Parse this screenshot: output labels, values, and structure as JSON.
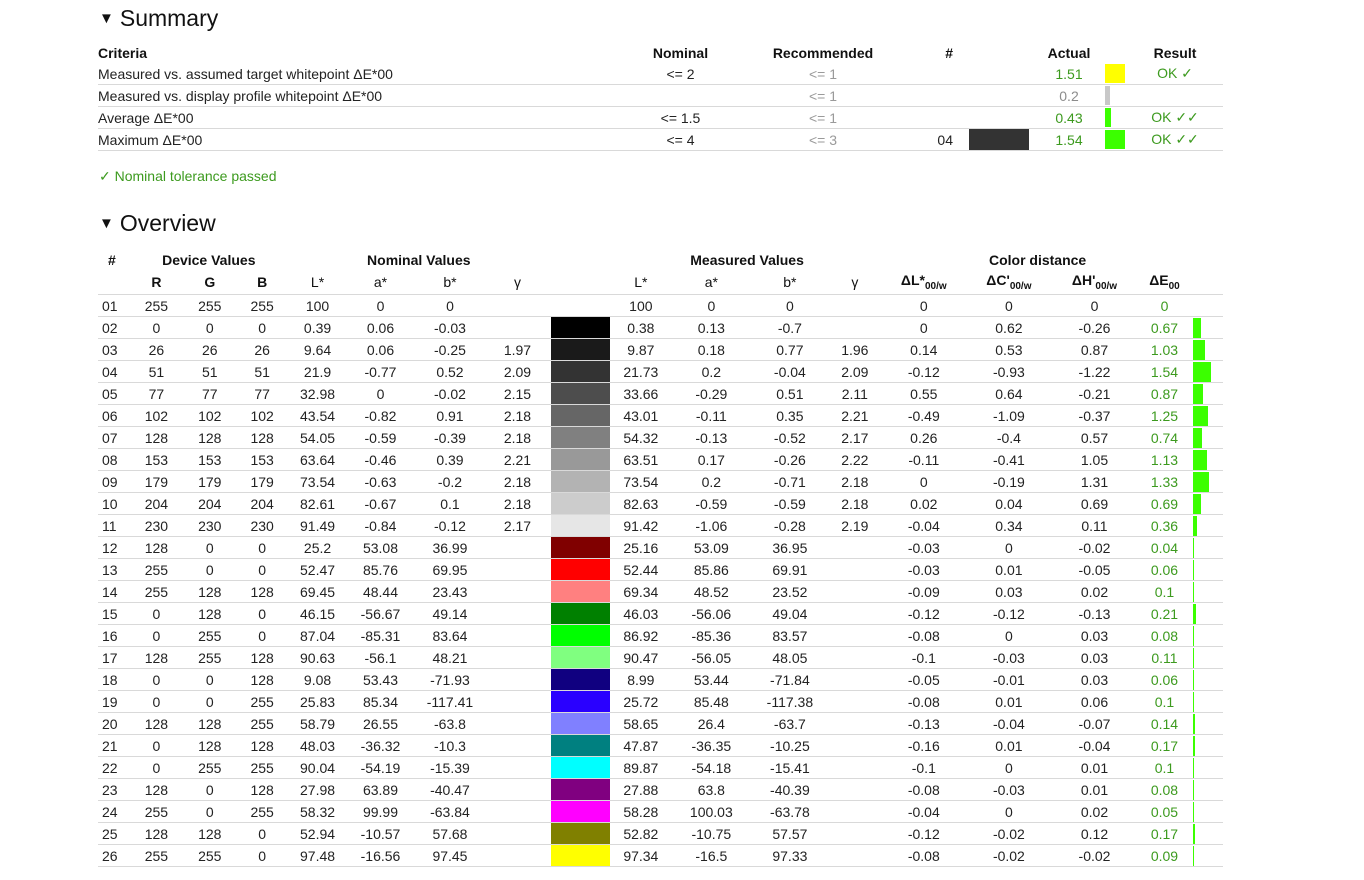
{
  "summary": {
    "title": "Summary",
    "headers": {
      "criteria": "Criteria",
      "nominal": "Nominal",
      "recommended": "Recommended",
      "hash": "#",
      "actual": "Actual",
      "result": "Result"
    },
    "rows": [
      {
        "criteria": "Measured vs. assumed target whitepoint ΔE*00",
        "nominal": "<= 2",
        "recommended": "<= 1",
        "patch": "",
        "actual": "1.51",
        "result": "OK ✓",
        "bar_color": "#ffff00",
        "actual_style": "green",
        "bar_fraction": 1.0
      },
      {
        "criteria": "Measured vs. display profile whitepoint ΔE*00",
        "nominal": "",
        "recommended": "<= 1",
        "patch": "",
        "actual": "0.2",
        "result": "",
        "bar_color": "#c8c8c8",
        "actual_style": "grey",
        "bar_fraction": 0.25
      },
      {
        "criteria": "Average ΔE*00",
        "nominal": "<= 1.5",
        "recommended": "<= 1",
        "patch": "",
        "actual": "0.43",
        "result": "OK ✓✓",
        "bar_color": "#3bff00",
        "actual_style": "green",
        "bar_fraction": 0.3
      },
      {
        "criteria": "Maximum ΔE*00",
        "nominal": "<= 4",
        "recommended": "<= 3",
        "patch": "04",
        "actual": "1.54",
        "result": "OK ✓✓",
        "bar_color": "#3bff00",
        "actual_style": "green",
        "bar_fraction": 1.0,
        "patch_color": "#333333"
      }
    ],
    "passed_text": "✓ Nominal tolerance passed"
  },
  "overview": {
    "title": "Overview",
    "group_headers": {
      "hash": "#",
      "device": "Device Values",
      "nominal": "Nominal Values",
      "measured": "Measured Values",
      "distance": "Color distance"
    },
    "sub_headers": [
      "R",
      "G",
      "B",
      "L*",
      "a*",
      "b*",
      "γ",
      "L*",
      "a*",
      "b*",
      "γ"
    ],
    "rows": [
      {
        "n": "01",
        "r": "255",
        "g": "255",
        "b": "255",
        "nl": "100",
        "na": "0",
        "nb": "0",
        "ng": "",
        "color": "#ffffff",
        "ml": "100",
        "ma": "0",
        "mb": "0",
        "mg": "",
        "dl": "0",
        "dc": "0",
        "dh": "0",
        "de": "0",
        "bar": 0
      },
      {
        "n": "02",
        "r": "0",
        "g": "0",
        "b": "0",
        "nl": "0.39",
        "na": "0.06",
        "nb": "-0.03",
        "ng": "",
        "color": "#000000",
        "ml": "0.38",
        "ma": "0.13",
        "mb": "-0.7",
        "mg": "",
        "dl": "0",
        "dc": "0.62",
        "dh": "-0.26",
        "de": "0.67",
        "bar": 0.67
      },
      {
        "n": "03",
        "r": "26",
        "g": "26",
        "b": "26",
        "nl": "9.64",
        "na": "0.06",
        "nb": "-0.25",
        "ng": "1.97",
        "color": "#1a1a1a",
        "ml": "9.87",
        "ma": "0.18",
        "mb": "0.77",
        "mg": "1.96",
        "dl": "0.14",
        "dc": "0.53",
        "dh": "0.87",
        "de": "1.03",
        "bar": 1.03
      },
      {
        "n": "04",
        "r": "51",
        "g": "51",
        "b": "51",
        "nl": "21.9",
        "na": "-0.77",
        "nb": "0.52",
        "ng": "2.09",
        "color": "#333333",
        "ml": "21.73",
        "ma": "0.2",
        "mb": "-0.04",
        "mg": "2.09",
        "dl": "-0.12",
        "dc": "-0.93",
        "dh": "-1.22",
        "de": "1.54",
        "bar": 1.54
      },
      {
        "n": "05",
        "r": "77",
        "g": "77",
        "b": "77",
        "nl": "32.98",
        "na": "0",
        "nb": "-0.02",
        "ng": "2.15",
        "color": "#4d4d4d",
        "ml": "33.66",
        "ma": "-0.29",
        "mb": "0.51",
        "mg": "2.11",
        "dl": "0.55",
        "dc": "0.64",
        "dh": "-0.21",
        "de": "0.87",
        "bar": 0.87
      },
      {
        "n": "06",
        "r": "102",
        "g": "102",
        "b": "102",
        "nl": "43.54",
        "na": "-0.82",
        "nb": "0.91",
        "ng": "2.18",
        "color": "#666666",
        "ml": "43.01",
        "ma": "-0.11",
        "mb": "0.35",
        "mg": "2.21",
        "dl": "-0.49",
        "dc": "-1.09",
        "dh": "-0.37",
        "de": "1.25",
        "bar": 1.25
      },
      {
        "n": "07",
        "r": "128",
        "g": "128",
        "b": "128",
        "nl": "54.05",
        "na": "-0.59",
        "nb": "-0.39",
        "ng": "2.18",
        "color": "#808080",
        "ml": "54.32",
        "ma": "-0.13",
        "mb": "-0.52",
        "mg": "2.17",
        "dl": "0.26",
        "dc": "-0.4",
        "dh": "0.57",
        "de": "0.74",
        "bar": 0.74
      },
      {
        "n": "08",
        "r": "153",
        "g": "153",
        "b": "153",
        "nl": "63.64",
        "na": "-0.46",
        "nb": "0.39",
        "ng": "2.21",
        "color": "#999999",
        "ml": "63.51",
        "ma": "0.17",
        "mb": "-0.26",
        "mg": "2.22",
        "dl": "-0.11",
        "dc": "-0.41",
        "dh": "1.05",
        "de": "1.13",
        "bar": 1.13
      },
      {
        "n": "09",
        "r": "179",
        "g": "179",
        "b": "179",
        "nl": "73.54",
        "na": "-0.63",
        "nb": "-0.2",
        "ng": "2.18",
        "color": "#b3b3b3",
        "ml": "73.54",
        "ma": "0.2",
        "mb": "-0.71",
        "mg": "2.18",
        "dl": "0",
        "dc": "-0.19",
        "dh": "1.31",
        "de": "1.33",
        "bar": 1.33
      },
      {
        "n": "10",
        "r": "204",
        "g": "204",
        "b": "204",
        "nl": "82.61",
        "na": "-0.67",
        "nb": "0.1",
        "ng": "2.18",
        "color": "#cccccc",
        "ml": "82.63",
        "ma": "-0.59",
        "mb": "-0.59",
        "mg": "2.18",
        "dl": "0.02",
        "dc": "0.04",
        "dh": "0.69",
        "de": "0.69",
        "bar": 0.69
      },
      {
        "n": "11",
        "r": "230",
        "g": "230",
        "b": "230",
        "nl": "91.49",
        "na": "-0.84",
        "nb": "-0.12",
        "ng": "2.17",
        "color": "#e6e6e6",
        "ml": "91.42",
        "ma": "-1.06",
        "mb": "-0.28",
        "mg": "2.19",
        "dl": "-0.04",
        "dc": "0.34",
        "dh": "0.11",
        "de": "0.36",
        "bar": 0.36
      },
      {
        "n": "12",
        "r": "128",
        "g": "0",
        "b": "0",
        "nl": "25.2",
        "na": "53.08",
        "nb": "36.99",
        "ng": "",
        "color": "#800000",
        "ml": "25.16",
        "ma": "53.09",
        "mb": "36.95",
        "mg": "",
        "dl": "-0.03",
        "dc": "0",
        "dh": "-0.02",
        "de": "0.04",
        "bar": 0.04
      },
      {
        "n": "13",
        "r": "255",
        "g": "0",
        "b": "0",
        "nl": "52.47",
        "na": "85.76",
        "nb": "69.95",
        "ng": "",
        "color": "#ff0000",
        "ml": "52.44",
        "ma": "85.86",
        "mb": "69.91",
        "mg": "",
        "dl": "-0.03",
        "dc": "0.01",
        "dh": "-0.05",
        "de": "0.06",
        "bar": 0.06
      },
      {
        "n": "14",
        "r": "255",
        "g": "128",
        "b": "128",
        "nl": "69.45",
        "na": "48.44",
        "nb": "23.43",
        "ng": "",
        "color": "#ff8080",
        "ml": "69.34",
        "ma": "48.52",
        "mb": "23.52",
        "mg": "",
        "dl": "-0.09",
        "dc": "0.03",
        "dh": "0.02",
        "de": "0.1",
        "bar": 0.1
      },
      {
        "n": "15",
        "r": "0",
        "g": "128",
        "b": "0",
        "nl": "46.15",
        "na": "-56.67",
        "nb": "49.14",
        "ng": "",
        "color": "#008000",
        "ml": "46.03",
        "ma": "-56.06",
        "mb": "49.04",
        "mg": "",
        "dl": "-0.12",
        "dc": "-0.12",
        "dh": "-0.13",
        "de": "0.21",
        "bar": 0.21
      },
      {
        "n": "16",
        "r": "0",
        "g": "255",
        "b": "0",
        "nl": "87.04",
        "na": "-85.31",
        "nb": "83.64",
        "ng": "",
        "color": "#00ff00",
        "ml": "86.92",
        "ma": "-85.36",
        "mb": "83.57",
        "mg": "",
        "dl": "-0.08",
        "dc": "0",
        "dh": "0.03",
        "de": "0.08",
        "bar": 0.08
      },
      {
        "n": "17",
        "r": "128",
        "g": "255",
        "b": "128",
        "nl": "90.63",
        "na": "-56.1",
        "nb": "48.21",
        "ng": "",
        "color": "#80ff80",
        "ml": "90.47",
        "ma": "-56.05",
        "mb": "48.05",
        "mg": "",
        "dl": "-0.1",
        "dc": "-0.03",
        "dh": "0.03",
        "de": "0.11",
        "bar": 0.11
      },
      {
        "n": "18",
        "r": "0",
        "g": "0",
        "b": "128",
        "nl": "9.08",
        "na": "53.43",
        "nb": "-71.93",
        "ng": "",
        "color": "#100080",
        "ml": "8.99",
        "ma": "53.44",
        "mb": "-71.84",
        "mg": "",
        "dl": "-0.05",
        "dc": "-0.01",
        "dh": "0.03",
        "de": "0.06",
        "bar": 0.06
      },
      {
        "n": "19",
        "r": "0",
        "g": "0",
        "b": "255",
        "nl": "25.83",
        "na": "85.34",
        "nb": "-117.41",
        "ng": "",
        "color": "#2a00ff",
        "ml": "25.72",
        "ma": "85.48",
        "mb": "-117.38",
        "mg": "",
        "dl": "-0.08",
        "dc": "0.01",
        "dh": "0.06",
        "de": "0.1",
        "bar": 0.1
      },
      {
        "n": "20",
        "r": "128",
        "g": "128",
        "b": "255",
        "nl": "58.79",
        "na": "26.55",
        "nb": "-63.8",
        "ng": "",
        "color": "#8080ff",
        "ml": "58.65",
        "ma": "26.4",
        "mb": "-63.7",
        "mg": "",
        "dl": "-0.13",
        "dc": "-0.04",
        "dh": "-0.07",
        "de": "0.14",
        "bar": 0.14
      },
      {
        "n": "21",
        "r": "0",
        "g": "128",
        "b": "128",
        "nl": "48.03",
        "na": "-36.32",
        "nb": "-10.3",
        "ng": "",
        "color": "#008080",
        "ml": "47.87",
        "ma": "-36.35",
        "mb": "-10.25",
        "mg": "",
        "dl": "-0.16",
        "dc": "0.01",
        "dh": "-0.04",
        "de": "0.17",
        "bar": 0.17
      },
      {
        "n": "22",
        "r": "0",
        "g": "255",
        "b": "255",
        "nl": "90.04",
        "na": "-54.19",
        "nb": "-15.39",
        "ng": "",
        "color": "#00ffff",
        "ml": "89.87",
        "ma": "-54.18",
        "mb": "-15.41",
        "mg": "",
        "dl": "-0.1",
        "dc": "0",
        "dh": "0.01",
        "de": "0.1",
        "bar": 0.1
      },
      {
        "n": "23",
        "r": "128",
        "g": "0",
        "b": "128",
        "nl": "27.98",
        "na": "63.89",
        "nb": "-40.47",
        "ng": "",
        "color": "#800080",
        "ml": "27.88",
        "ma": "63.8",
        "mb": "-40.39",
        "mg": "",
        "dl": "-0.08",
        "dc": "-0.03",
        "dh": "0.01",
        "de": "0.08",
        "bar": 0.08
      },
      {
        "n": "24",
        "r": "255",
        "g": "0",
        "b": "255",
        "nl": "58.32",
        "na": "99.99",
        "nb": "-63.84",
        "ng": "",
        "color": "#ff00ff",
        "ml": "58.28",
        "ma": "100.03",
        "mb": "-63.78",
        "mg": "",
        "dl": "-0.04",
        "dc": "0",
        "dh": "0.02",
        "de": "0.05",
        "bar": 0.05
      },
      {
        "n": "25",
        "r": "128",
        "g": "128",
        "b": "0",
        "nl": "52.94",
        "na": "-10.57",
        "nb": "57.68",
        "ng": "",
        "color": "#808000",
        "ml": "52.82",
        "ma": "-10.75",
        "mb": "57.57",
        "mg": "",
        "dl": "-0.12",
        "dc": "-0.02",
        "dh": "0.12",
        "de": "0.17",
        "bar": 0.17
      },
      {
        "n": "26",
        "r": "255",
        "g": "255",
        "b": "0",
        "nl": "97.48",
        "na": "-16.56",
        "nb": "97.45",
        "ng": "",
        "color": "#ffff00",
        "ml": "97.34",
        "ma": "-16.5",
        "mb": "97.33",
        "mg": "",
        "dl": "-0.08",
        "dc": "-0.02",
        "dh": "-0.02",
        "de": "0.09",
        "bar": 0.09
      }
    ]
  }
}
